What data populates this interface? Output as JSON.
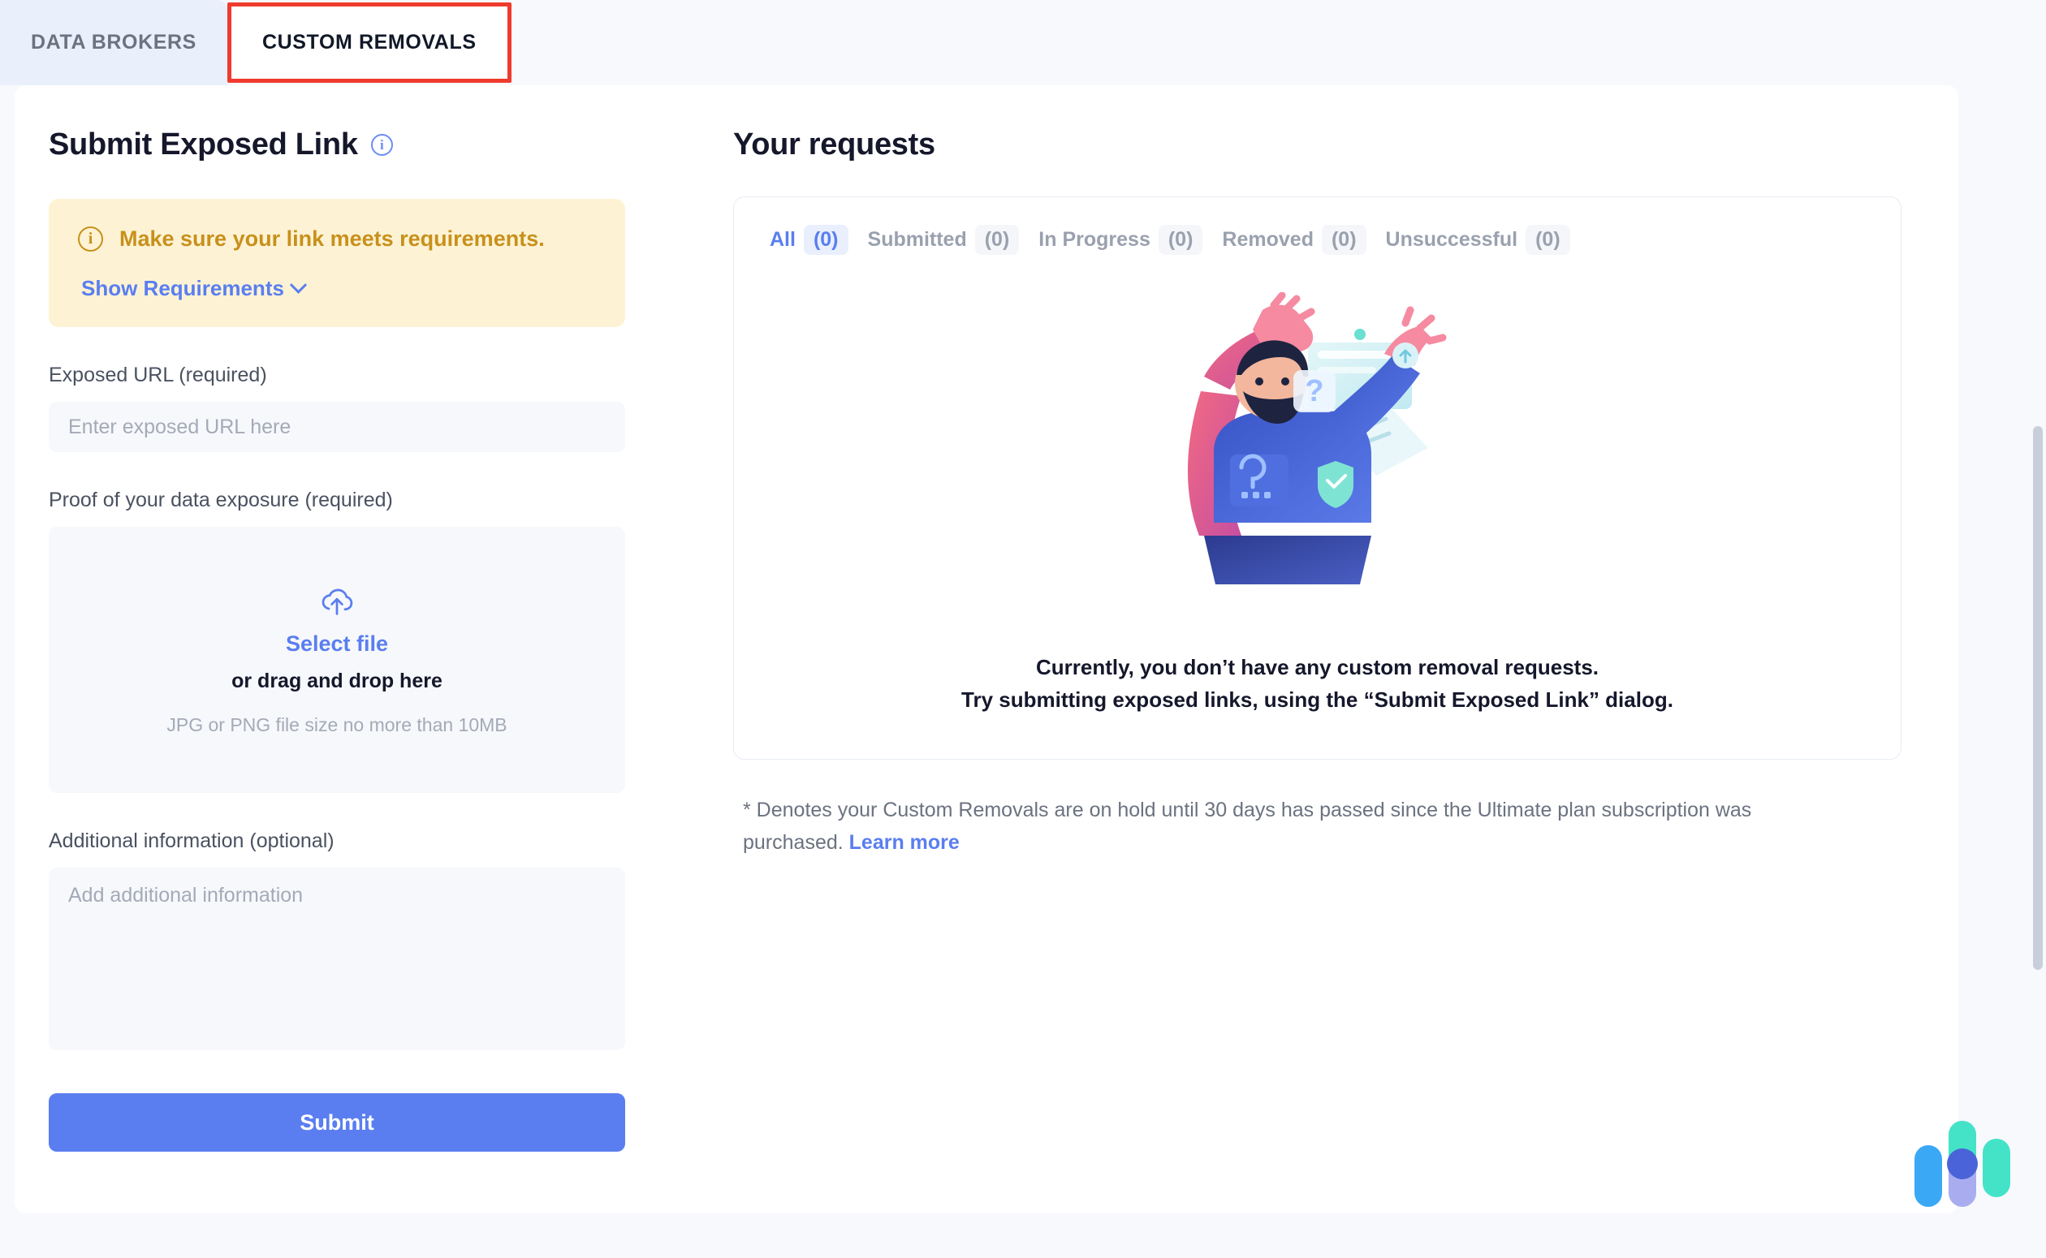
{
  "tabs": [
    {
      "label": "DATA BROKERS",
      "active": false
    },
    {
      "label": "CUSTOM REMOVALS",
      "active": true
    }
  ],
  "left_panel": {
    "title": "Submit Exposed Link",
    "info_icon": "info-icon",
    "notice": {
      "icon": "info-icon",
      "text": "Make sure your link meets requirements.",
      "link_label": "Show Requirements",
      "chevron": "chevron-down-icon",
      "bg_color": "#fdf3d4",
      "text_color": "#c8901c"
    },
    "url_field": {
      "label": "Exposed URL (required)",
      "placeholder": "Enter exposed URL here",
      "value": ""
    },
    "proof_field": {
      "label": "Proof of your data exposure (required)",
      "upload_icon": "upload-cloud-icon",
      "select_label": "Select file",
      "drag_label": "or drag and drop here",
      "hint": "JPG or PNG file size no more than 10MB"
    },
    "additional_field": {
      "label": "Additional information (optional)",
      "placeholder": "Add additional information",
      "value": ""
    },
    "submit_label": "Submit",
    "submit_color": "#5a7ef0"
  },
  "right_panel": {
    "title": "Your requests",
    "filters": [
      {
        "label": "All",
        "count": "(0)",
        "active": true
      },
      {
        "label": "Submitted",
        "count": "(0)",
        "active": false
      },
      {
        "label": "In Progress",
        "count": "(0)",
        "active": false
      },
      {
        "label": "Removed",
        "count": "(0)",
        "active": false
      },
      {
        "label": "Unsuccessful",
        "count": "(0)",
        "active": false
      }
    ],
    "illustration": "person-with-documents-illustration",
    "empty_line1": "Currently, you don’t have any custom removal requests.",
    "empty_line2": "Try submitting exposed links, using the “Submit Exposed Link” dialog.",
    "footnote_text": "* Denotes your Custom Removals are on hold until 30 days has passed since the Ultimate plan subscription was purchased. ",
    "footnote_link": "Learn more"
  },
  "widget": {
    "name": "chat-widget"
  }
}
